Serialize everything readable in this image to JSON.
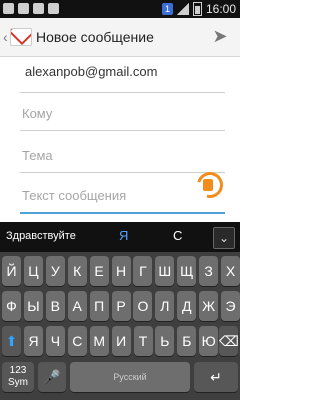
{
  "status_bar": {
    "time": "16:00",
    "notification_count": "1"
  },
  "action_bar": {
    "title": "Новое сообщение"
  },
  "compose": {
    "from": "alexanpob@gmail.com",
    "to_placeholder": "Кому",
    "subject_placeholder": "Тема",
    "body_placeholder": "Текст сообщения"
  },
  "keyboard": {
    "suggestions": [
      "Здравствуйте",
      "Я",
      "С"
    ],
    "row1": [
      "Й",
      "Ц",
      "У",
      "К",
      "Е",
      "Н",
      "Г",
      "Ш",
      "Щ",
      "З",
      "Х"
    ],
    "row2": [
      "Ф",
      "Ы",
      "В",
      "А",
      "П",
      "Р",
      "О",
      "Л",
      "Д",
      "Ж",
      "Э"
    ],
    "row3": [
      "Я",
      "Ч",
      "С",
      "М",
      "И",
      "Т",
      "Ь",
      "Б",
      "Ю"
    ],
    "sym_label": "123\nSym",
    "space_label": "Русский",
    "colors": {
      "accent": "#4da3d6",
      "handle": "#f28c1b",
      "suggest_highlight": "#4da3ff"
    }
  },
  "icons": [
    "gmail-icon",
    "send-icon",
    "back-chevron-icon",
    "shift-icon",
    "backspace-icon",
    "enter-icon",
    "mic-icon",
    "chevron-down-icon"
  ]
}
